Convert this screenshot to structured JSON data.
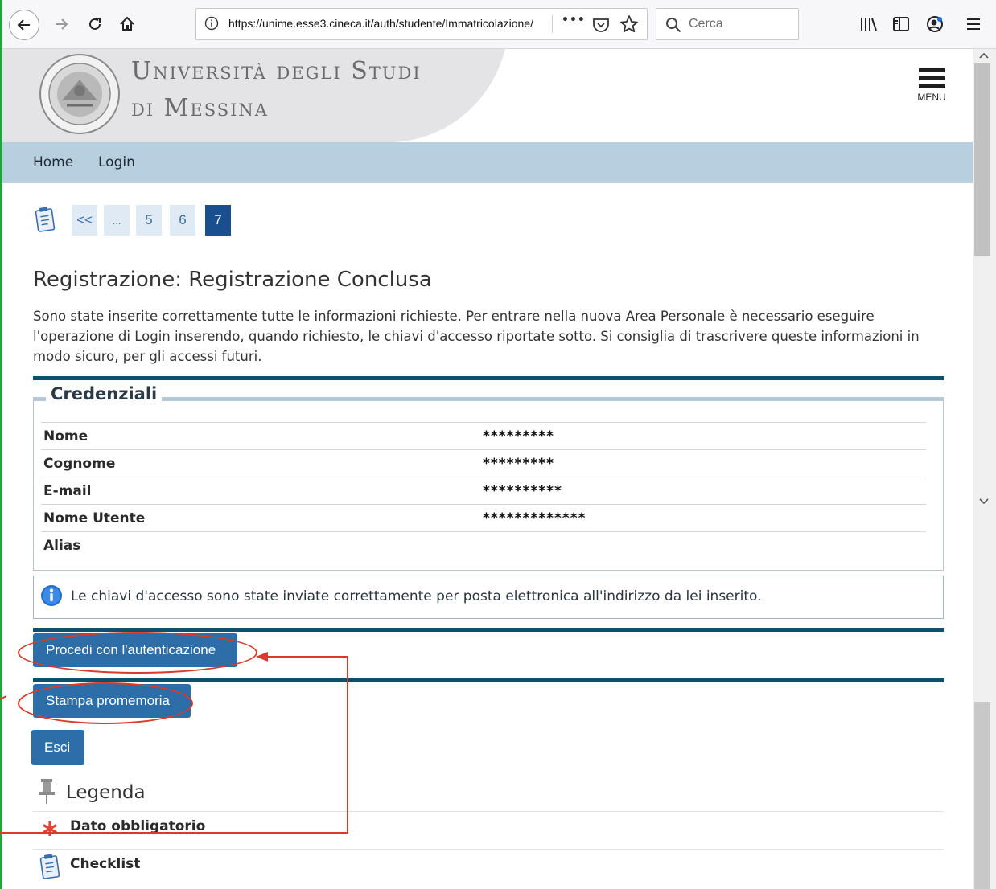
{
  "browser": {
    "url": "https://unime.esse3.cineca.it/auth/studente/Immatricolazione/",
    "search_placeholder": "Cerca",
    "url_menu": "•••"
  },
  "header": {
    "univ_line1": "Università degli Studi",
    "univ_line2": "di Messina",
    "menu_label": "MENU"
  },
  "nav": {
    "home": "Home",
    "login": "Login"
  },
  "steps": {
    "first": "<<",
    "ellipsis": "...",
    "items": [
      "5",
      "6",
      "7"
    ],
    "active": "7"
  },
  "page": {
    "title": "Registrazione: Registrazione Conclusa",
    "intro": "Sono state inserite correttamente tutte le informazioni richieste. Per entrare nella nuova Area Personale è necessario eseguire l'operazione di Login inserendo, quando richiesto, le chiavi d'accesso riportate sotto. Si consiglia di trascrivere queste informazioni in modo sicuro, per gli accessi futuri."
  },
  "credenziali": {
    "title": "Credenziali",
    "rows": [
      {
        "label": "Nome",
        "value": "*********"
      },
      {
        "label": "Cognome",
        "value": "*********"
      },
      {
        "label": "E-mail",
        "value": "**********"
      },
      {
        "label": "Nome Utente",
        "value": "*************"
      },
      {
        "label": "Alias",
        "value": ""
      }
    ]
  },
  "info": {
    "message": "Le chiavi d'accesso sono state inviate correttamente per posta elettronica all'indirizzo da lei inserito."
  },
  "buttons": {
    "procedi": "Procedi con l'autenticazione",
    "stampa": "Stampa promemoria",
    "esci": "Esci"
  },
  "legenda": {
    "title": "Legenda",
    "items": [
      {
        "label": "Dato obbligatorio",
        "icon": "required-asterisk-icon"
      },
      {
        "label": "Checklist",
        "icon": "checklist-icon"
      }
    ]
  },
  "colors": {
    "nav_bg": "#b8cfdf",
    "button": "#2d6ea8",
    "step_active": "#1a4f8f",
    "rule_dark": "#0f4f6e",
    "annotation": "#d93a2b"
  }
}
